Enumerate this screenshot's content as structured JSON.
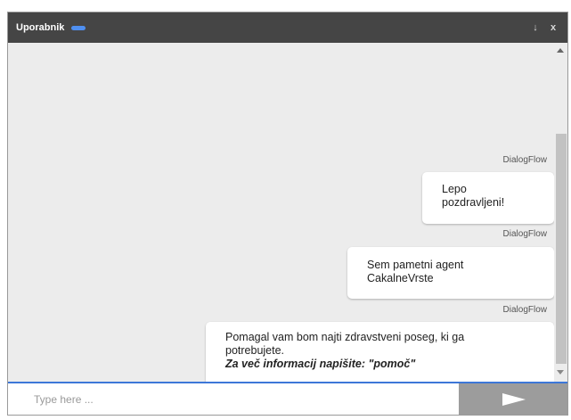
{
  "window": {
    "title": "Uporabnik",
    "minimize_glyph": "↓",
    "close_glyph": "x"
  },
  "messages": [
    {
      "sender": "DialogFlow",
      "lines": [
        "Lepo",
        "pozdravljeni!"
      ]
    },
    {
      "sender": "DialogFlow",
      "lines": [
        "Sem pametni agent",
        "CakalneVrste"
      ]
    },
    {
      "sender": "DialogFlow",
      "lines": [
        "Pomagal vam bom najti zdravstveni poseg, ki ga",
        "potrebujete."
      ],
      "emphasis": "Za več informacij napišite: \"pomoč\""
    }
  ],
  "input": {
    "placeholder": "Type here ..."
  },
  "colors": {
    "titlebar": "#454545",
    "accent": "#3d77d8",
    "send_button": "#9c9c9c"
  },
  "icons": {
    "send": "send-arrow-icon",
    "minimize": "minimize-icon",
    "close": "close-icon"
  }
}
